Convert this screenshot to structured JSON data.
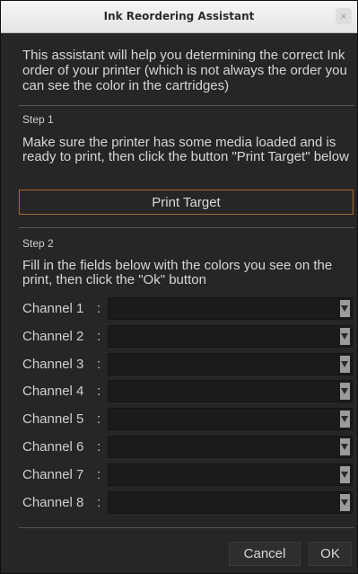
{
  "window": {
    "title": "Ink Reordering Assistant",
    "close_glyph": "×"
  },
  "intro": "This assistant will help you determining the correct Ink order of your printer (which is not always the order you can see the color in the cartridges)",
  "step1": {
    "heading": "Step 1",
    "text": "Make sure the printer has some media loaded and is ready to print, then click the button \"Print Target\" below",
    "button_label": "Print Target"
  },
  "step2": {
    "heading": "Step 2",
    "text": "Fill in the fields below with the colors you see on the print, then click the \"Ok\" button",
    "colon": ":",
    "channels": [
      {
        "label": "Channel 1",
        "value": ""
      },
      {
        "label": "Channel 2",
        "value": ""
      },
      {
        "label": "Channel 3",
        "value": ""
      },
      {
        "label": "Channel 4",
        "value": ""
      },
      {
        "label": "Channel 5",
        "value": ""
      },
      {
        "label": "Channel 6",
        "value": ""
      },
      {
        "label": "Channel 7",
        "value": ""
      },
      {
        "label": "Channel 8",
        "value": ""
      }
    ]
  },
  "footer": {
    "cancel_label": "Cancel",
    "ok_label": "OK"
  },
  "colors": {
    "background": "#262626",
    "combo_background": "#1b1b1b",
    "accent_border": "#a86a2e",
    "text": "#d6d6d6"
  },
  "icons": {
    "close": "close-icon",
    "dropdown": "chevron-down-icon"
  }
}
